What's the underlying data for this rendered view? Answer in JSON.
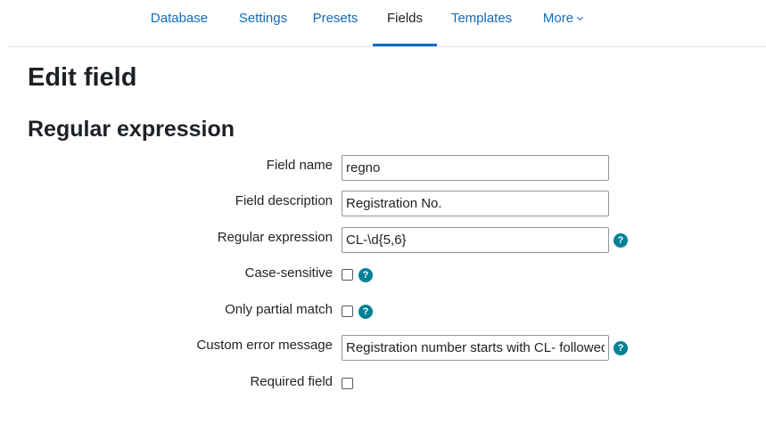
{
  "nav": {
    "tabs": [
      {
        "label": "Database",
        "active": false
      },
      {
        "label": "Settings",
        "active": false
      },
      {
        "label": "Presets",
        "active": false
      },
      {
        "label": "Fields",
        "active": true
      },
      {
        "label": "Templates",
        "active": false
      },
      {
        "label": "More",
        "active": false,
        "has_dropdown": true
      }
    ]
  },
  "page_title": "Edit field",
  "section_title": "Regular expression",
  "form": {
    "field_name": {
      "label": "Field name",
      "value": "regno"
    },
    "field_description": {
      "label": "Field description",
      "value": "Registration No."
    },
    "regular_expression": {
      "label": "Regular expression",
      "value": "CL-\\d{5,6}",
      "help": "?"
    },
    "case_sensitive": {
      "label": "Case-sensitive",
      "checked": false,
      "help": "?"
    },
    "partial_match": {
      "label": "Only partial match",
      "checked": false,
      "help": "?"
    },
    "custom_error": {
      "label": "Custom error message",
      "value": "Registration number starts with CL- followed",
      "help": "?"
    },
    "required": {
      "label": "Required field",
      "checked": false
    }
  },
  "colors": {
    "link": "#0f6cbf",
    "text": "#1d2125",
    "help_icon": "#008196",
    "border": "#8f959e"
  },
  "icons": {
    "help": "question-circle-icon",
    "more_dropdown": "chevron-down-icon"
  }
}
